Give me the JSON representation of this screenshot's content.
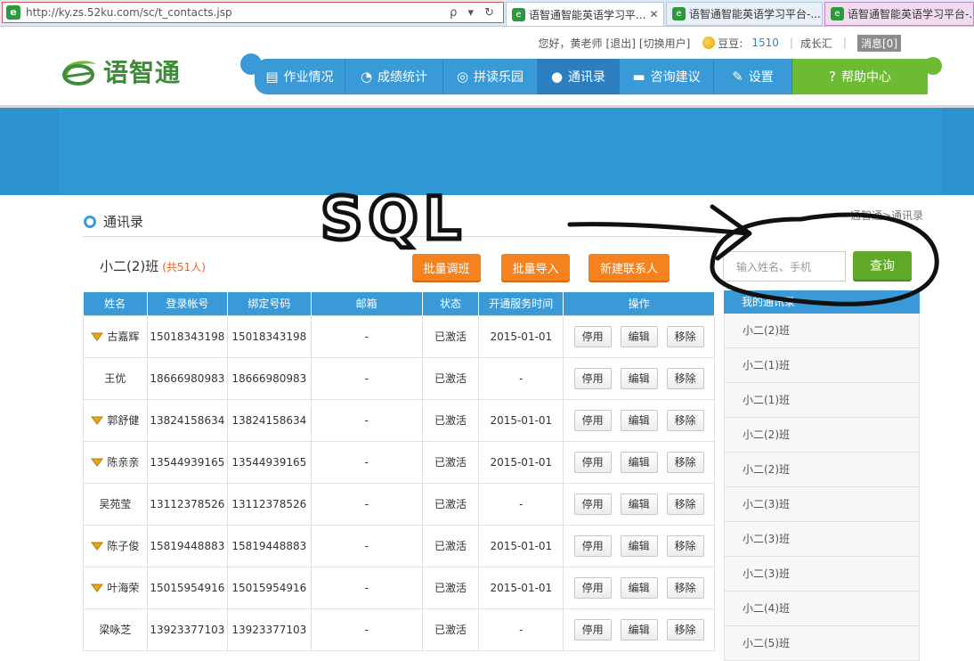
{
  "browser": {
    "url": "http://ky.zs.52ku.com/sc/t_contacts.jsp",
    "tools": "ρ ▾ ↻",
    "tabs": [
      {
        "title": "语智通智能英语学习平...",
        "close": "✕"
      },
      {
        "title": "语智通智能英语学习平台-..."
      },
      {
        "title": "语智通智能英语学习平台-..."
      }
    ]
  },
  "userbar": {
    "greeting": "您好，黄老师",
    "logout": "[退出]",
    "switch_user": "[切换用户]",
    "beans_label": "豆豆:",
    "beans_value": "1510",
    "growth": "成长汇",
    "messages": "消息[0]"
  },
  "logo": {
    "text": "语智通"
  },
  "nav": [
    {
      "label": "作业情况",
      "icon": "document-icon"
    },
    {
      "label": "成绩统计",
      "icon": "pie-chart-icon"
    },
    {
      "label": "拼读乐园",
      "icon": "globe-icon"
    },
    {
      "label": "通讯录",
      "icon": "user-icon"
    },
    {
      "label": "咨询建议",
      "icon": "chat-icon"
    },
    {
      "label": "设置",
      "icon": "wrench-icon"
    },
    {
      "label": "帮助中心",
      "icon": "help-icon"
    }
  ],
  "section": {
    "title": "通讯录",
    "breadcrumb": "通智通>通讯录"
  },
  "class_info": {
    "name": "小二(2)班",
    "count": "(共51人)"
  },
  "actions": {
    "batch_transfer": "批量调班",
    "batch_import": "批量导入",
    "new_contact": "新建联系人"
  },
  "search": {
    "placeholder": "输入姓名、手机",
    "button": "查询"
  },
  "annotation": {
    "text": "SQL"
  },
  "table": {
    "headers": [
      "姓名",
      "登录帐号",
      "绑定号码",
      "邮箱",
      "状态",
      "开通服务时间",
      "操作"
    ],
    "op_labels": {
      "disable": "停用",
      "edit": "编辑",
      "remove": "移除"
    },
    "rows": [
      {
        "vip": true,
        "name": "古嘉辉",
        "account": "15018343198",
        "phone": "15018343198",
        "email": "-",
        "status": "已激活",
        "since": "2015-01-01"
      },
      {
        "vip": false,
        "name": "王优",
        "account": "18666980983",
        "phone": "18666980983",
        "email": "-",
        "status": "已激活",
        "since": "-"
      },
      {
        "vip": true,
        "name": "郭舒健",
        "account": "13824158634",
        "phone": "13824158634",
        "email": "-",
        "status": "已激活",
        "since": "2015-01-01"
      },
      {
        "vip": true,
        "name": "陈亲亲",
        "account": "13544939165",
        "phone": "13544939165",
        "email": "-",
        "status": "已激活",
        "since": "2015-01-01"
      },
      {
        "vip": false,
        "name": "吴苑莹",
        "account": "13112378526",
        "phone": "13112378526",
        "email": "-",
        "status": "已激活",
        "since": "-"
      },
      {
        "vip": true,
        "name": "陈子俊",
        "account": "15819448883",
        "phone": "15819448883",
        "email": "-",
        "status": "已激活",
        "since": "2015-01-01"
      },
      {
        "vip": true,
        "name": "叶海荣",
        "account": "15015954916",
        "phone": "15015954916",
        "email": "-",
        "status": "已激活",
        "since": "2015-01-01"
      },
      {
        "vip": false,
        "name": "梁咏芝",
        "account": "13923377103",
        "phone": "13923377103",
        "email": "-",
        "status": "已激活",
        "since": "-"
      }
    ]
  },
  "sidebar": {
    "header": "我的通讯录",
    "classes": [
      "小二(2)班",
      "小二(1)班",
      "小二(1)班",
      "小二(2)班",
      "小二(2)班",
      "小二(3)班",
      "小二(3)班",
      "小二(3)班",
      "小二(4)班",
      "小二(5)班"
    ]
  },
  "colors": {
    "brand_blue": "#3a9ad8",
    "orange": "#f5821f",
    "green": "#5fa828",
    "help_green": "#6dbb33"
  }
}
